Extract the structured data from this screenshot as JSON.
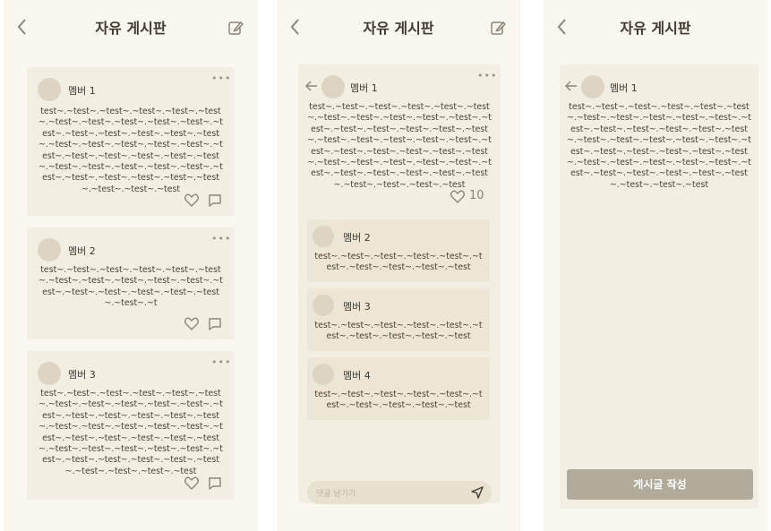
{
  "screen_list": {
    "title": "자유 게시판",
    "posts": [
      {
        "author": "멤버 1",
        "body": "test~.~test~.~test~.~test~.~test~.~test~.~test~.~test~.~test~.~test~.~test~.~test~.~test~.~test~.~test~.~test~.~test~.~test~.~test~.~test~.~test~.~test~.~test~.~test~.~test~.~test~.~test~.~test~.~test~.~test~.~test~.~test~.~test~.~test~.~test~.~test~.~test~.~test~.~test~.~test~.~test~.~test"
      },
      {
        "author": "멤버 2",
        "body": "test~.~test~.~test~.~test~.~test~.~test~.~test~.~test~.~test~.~test~.~test~.~test~.~test~.~test~.~test~.~test~.~test~.~test~.~t"
      },
      {
        "author": "멤버 3",
        "body": "test~.~test~.~test~.~test~.~test~.~test~.~test~.~test~.~test~.~test~.~test~.~test~.~test~.~test~.~test~.~test~.~test~.~test~.~test~.~test~.~test~.~test~.~test~.~test~.~test~.~test~.~test~.~test~.~test~.~test~.~test~.~test~.~test~.~test~.~test~.~test~.~test~.~test~.~test~.~test~.~test~.~test~.~test"
      }
    ]
  },
  "screen_detail": {
    "title": "자유 게시판",
    "post": {
      "author": "멤버 1",
      "body": "test~.~test~.~test~.~test~.~test~.~test~.~test~.~test~.~test~.~test~.~test~.~test~.~test~.~test~.~test~.~test~.~test~.~test~.~test~.~test~.~test~.~test~.~test~.~test~.~test~.~test~.~test~.~test~.~test~.~test~.~test~.~test~.~test~.~test~.~test~.~test~.~test~.~test~.~test~.~test~.~test~.~test~.~test",
      "like_count": "10"
    },
    "replies": [
      {
        "author": "멤버 2",
        "body": "test~.~test~.~test~.~test~.~test~.~test~.~test~.~test~.~test~.~test"
      },
      {
        "author": "멤버 3",
        "body": "test~.~test~.~test~.~test~.~test~.~test~.~test~.~test~.~test~.~test"
      },
      {
        "author": "멤버 4",
        "body": "test~.~test~.~test~.~test~.~test~.~test~.~test~.~test~.~test~.~test"
      }
    ],
    "comment_placeholder": "댓글 남기기"
  },
  "screen_write": {
    "title": "자유 게시판",
    "post": {
      "author": "멤버 1",
      "body": "test~.~test~.~test~.~test~.~test~.~test~.~test~.~test~.~test~.~test~.~test~.~test~.~test~.~test~.~test~.~test~.~test~.~test~.~test~.~test~.~test~.~test~.~test~.~test~.~test~.~test~.~test~.~test~.~test~.~test~.~test~.~test~.~test~.~test~.~test~.~test~.~test~.~test~.~test~.~test~.~test~.~test"
    },
    "write_button_label": "게시글 작성"
  },
  "icons": {
    "back": "chevron-left-icon",
    "edit": "edit-icon",
    "more": "more-dots-icon",
    "like": "heart-icon",
    "comment": "comment-icon",
    "send": "send-icon",
    "reply_arrow": "arrow-left-icon"
  },
  "colors": {
    "background": "#faf7ef",
    "card": "#f2eee2",
    "reply_card": "#ebe6d6",
    "avatar": "#ddd4c3",
    "button": "#b0ab9b"
  }
}
